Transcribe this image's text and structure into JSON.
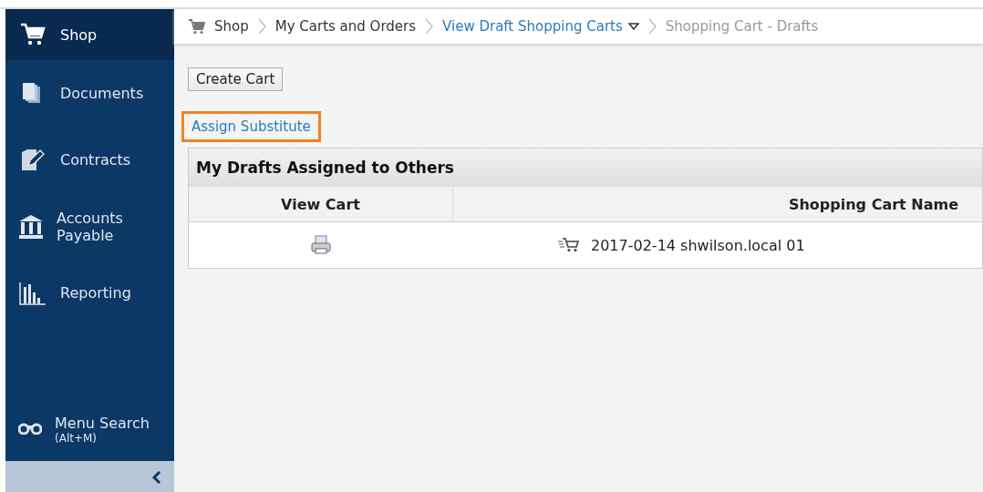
{
  "sidebar": {
    "items": [
      {
        "label": "Shop",
        "selected": true
      },
      {
        "label": "Documents",
        "selected": false
      },
      {
        "label": "Contracts",
        "selected": false
      },
      {
        "label": "Accounts Payable",
        "selected": false
      },
      {
        "label": "Reporting",
        "selected": false
      }
    ],
    "menu_search": {
      "label": "Menu Search",
      "shortcut": "(Alt+M)"
    }
  },
  "breadcrumb": [
    {
      "label": "Shop",
      "kind": "plain",
      "has_menu": false
    },
    {
      "label": "My Carts and Orders",
      "kind": "plain",
      "has_menu": false
    },
    {
      "label": "View Draft Shopping Carts",
      "kind": "link",
      "has_menu": true
    },
    {
      "label": "Shopping Cart - Drafts",
      "kind": "current",
      "has_menu": false
    }
  ],
  "create_button": "Create Cart",
  "assign_link": {
    "label": "Assign Substitute",
    "highlighted": true
  },
  "panel": {
    "title": "My Drafts Assigned to Others",
    "columns": [
      "View Cart",
      "Shopping Cart Name"
    ],
    "rows": [
      {
        "name": "2017-02-14 shwilson.local 01"
      }
    ]
  }
}
